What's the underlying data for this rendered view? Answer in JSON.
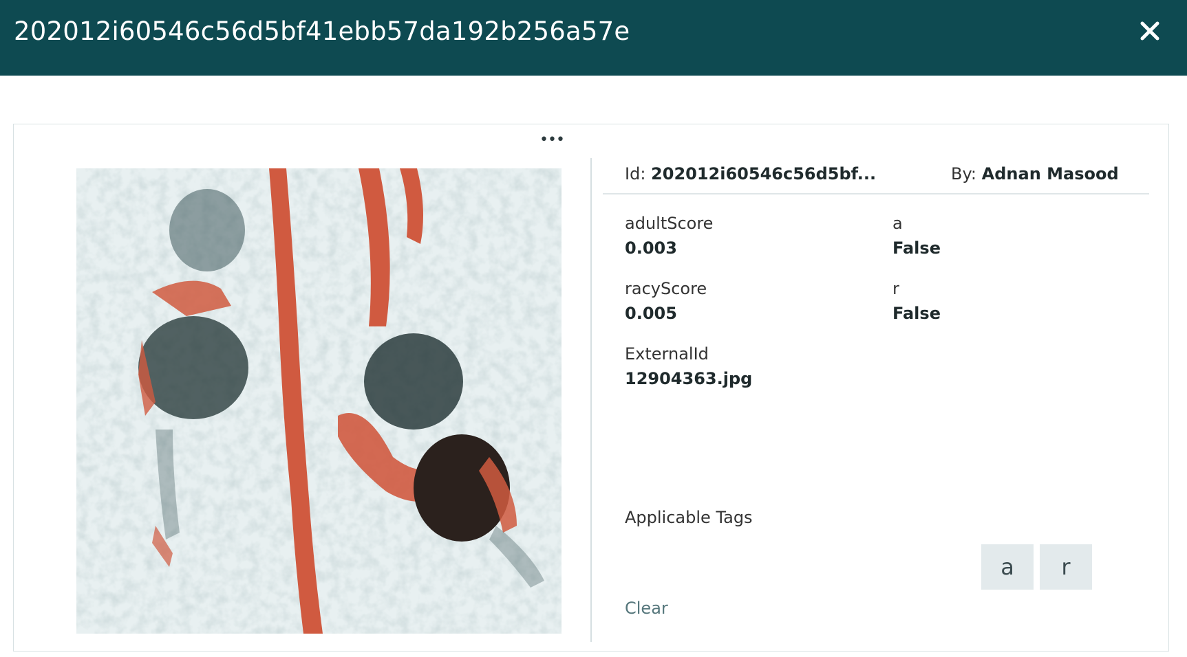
{
  "header": {
    "title": "202012i60546c56d5bf41ebb57da192b256a57e",
    "close_icon": "close-icon"
  },
  "card": {
    "more_icon": "more-horizontal-icon",
    "more_label": "•••",
    "meta": {
      "id_label": "Id:",
      "id_value": "202012i60546c56d5bf...",
      "by_label": "By:",
      "by_value": "Adnan Masood"
    },
    "fields": [
      {
        "key": "adultScore",
        "value": "0.003"
      },
      {
        "key": "a",
        "value": "False"
      },
      {
        "key": "racyScore",
        "value": "0.005"
      },
      {
        "key": "r",
        "value": "False"
      },
      {
        "key": "ExternalId",
        "value": "12904363.jpg"
      }
    ],
    "tags_label": "Applicable Tags",
    "tags": [
      "a",
      "r"
    ],
    "clear_label": "Clear"
  },
  "colors": {
    "brand": "#0e4a51",
    "lane_rope": "#d05a40",
    "water": "#e8f0f1"
  }
}
